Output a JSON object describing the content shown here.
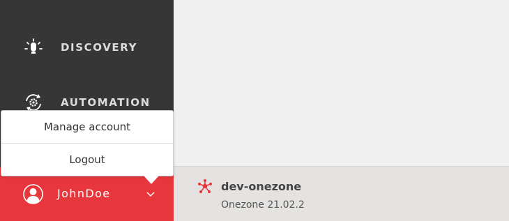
{
  "sidebar": {
    "items": [
      {
        "label": "DISCOVERY",
        "icon": "lightbulb-icon"
      },
      {
        "label": "AUTOMATION",
        "icon": "gear-cycle-icon"
      }
    ]
  },
  "user": {
    "name": "JohnDoe",
    "avatar_icon": "user-avatar-icon",
    "chevron_icon": "chevron-down-icon"
  },
  "user_menu": {
    "items": [
      {
        "label": "Manage account"
      },
      {
        "label": "Logout"
      }
    ]
  },
  "footer": {
    "zone_name": "dev-onezone",
    "zone_version": "Onezone 21.02.2",
    "zone_icon": "network-nodes-icon"
  },
  "colors": {
    "sidebar_bg": "#363636",
    "accent_red": "#e8373c",
    "footer_bg": "#e4e3e1",
    "main_bg": "#f0f0f0"
  }
}
